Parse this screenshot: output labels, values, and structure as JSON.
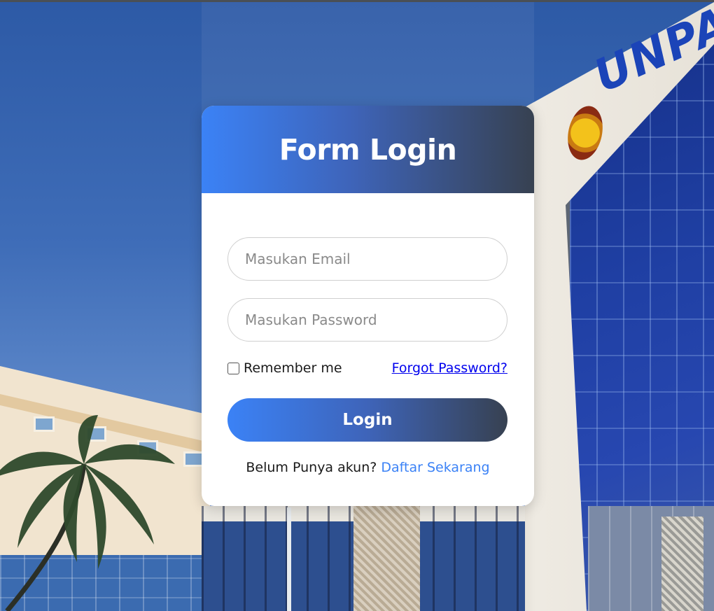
{
  "card": {
    "title": "Form Login",
    "email_placeholder": "Masukan Email",
    "password_placeholder": "Masukan Password",
    "remember_label": "Remember me",
    "remember_checked": false,
    "forgot_label": "Forgot Password?",
    "login_label": "Login",
    "signup_prompt": "Belum Punya akun?",
    "signup_link": "Daftar Sekarang"
  },
  "background": {
    "building_sign": "UNPA"
  },
  "colors": {
    "gradient_start": "#3b82f6",
    "gradient_end": "#374151",
    "link_blue": "#3b82f6",
    "forgot_link": "#0000ee"
  }
}
